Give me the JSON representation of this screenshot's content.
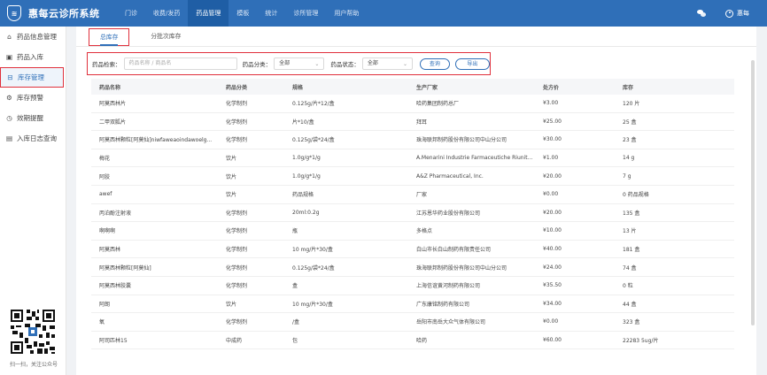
{
  "app": {
    "title": "惠每云诊所系统",
    "logo_glyph": "≋"
  },
  "nav": [
    "门诊",
    "收费/发药",
    "药品管理",
    "模板",
    "统计",
    "诊所管理",
    "用户帮助"
  ],
  "nav_active_index": 2,
  "user": {
    "name": "惠每"
  },
  "sidebar": {
    "items": [
      {
        "label": "药品信息管理",
        "icon": "capsule-icon",
        "glyph": "⌂"
      },
      {
        "label": "药品入库",
        "icon": "inbox-icon",
        "glyph": "▣"
      },
      {
        "label": "库存管理",
        "icon": "warehouse-icon",
        "glyph": "⊟"
      },
      {
        "label": "库存预警",
        "icon": "alert-icon",
        "glyph": "⚙"
      },
      {
        "label": "效期提醒",
        "icon": "clock-icon",
        "glyph": "◷"
      },
      {
        "label": "入库日志查询",
        "icon": "log-icon",
        "glyph": "▤"
      }
    ],
    "active_index": 2,
    "qr_caption": "扫一扫，关注公众号"
  },
  "tabs": [
    "总库存",
    "分批次库存"
  ],
  "filter": {
    "search_label": "药品检索：",
    "search_placeholder": "药品名称 / 商品名",
    "category_label": "药品分类：",
    "category_value": "全部",
    "status_label": "药品状态：",
    "status_value": "全部",
    "query_button": "查询",
    "export_button": "导出"
  },
  "table": {
    "headers": [
      "药品名称",
      "药品分类",
      "规格",
      "生产厂家",
      "处方价",
      "库存"
    ],
    "rows": [
      [
        "阿莫西林片",
        "化学制剂",
        "0.125g/片*12/盒",
        "哈药集团制药总厂",
        "¥3.00",
        "120 片"
      ],
      [
        "二甲双胍片",
        "化学制剂",
        "片*10/盒",
        "拜耳",
        "¥25.00",
        "25 盒"
      ],
      [
        "阿莫西林颗粒[阿莫仙]niwfaweaoindawoelg...",
        "化学制剂",
        "0.125g/袋*24/盒",
        "珠海联邦制药股份有限公司中山分公司",
        "¥30.00",
        "23 盒"
      ],
      [
        "梅花",
        "饮片",
        "1.0g/g*1/g",
        "A.Menarini Industrie Farmaceutiche Riunit...",
        "¥1.00",
        "14 g"
      ],
      [
        "阿胶",
        "饮片",
        "1.0g/g*1/g",
        "A&Z Pharmaceutical, Inc.",
        "¥20.00",
        "7 g"
      ],
      [
        "awef",
        "饮片",
        "药品规格",
        "厂家",
        "¥0.00",
        "0 药品规格"
      ],
      [
        "丙泊酚注射液",
        "化学制剂",
        "20ml:0.2g",
        "江苏恩华药业股份有限公司",
        "¥20.00",
        "135 盒"
      ],
      [
        "啊啊啊",
        "化学制剂",
        "瓶",
        "多格点",
        "¥10.00",
        "13 片"
      ],
      [
        "阿莫西林",
        "化学制剂",
        "10 mg/片*30/盒",
        "白山市长白山制药有限责任公司",
        "¥40.00",
        "181 盒"
      ],
      [
        "阿莫西林颗粒[阿莫仙]",
        "化学制剂",
        "0.125g/袋*24/盒",
        "珠海联邦制药股份有限公司中山分公司",
        "¥24.00",
        "74 盒"
      ],
      [
        "阿莫西林胶囊",
        "化学制剂",
        "盒",
        "上海信谊黄河制药有限公司",
        "¥35.50",
        "0 粒"
      ],
      [
        "阿朗",
        "饮片",
        "10 mg/片*30/盒",
        "广东康铭制药有限公司",
        "¥34.00",
        "44 盒"
      ],
      [
        "氧",
        "化学制剂",
        "/盒",
        "岳阳市南岳大众气体有限公司",
        "¥0.00",
        "323 盒"
      ],
      [
        "阿司匹林15",
        "中成药",
        "包",
        "哈药",
        "¥60.00",
        "22283 5ug/片"
      ]
    ]
  }
}
